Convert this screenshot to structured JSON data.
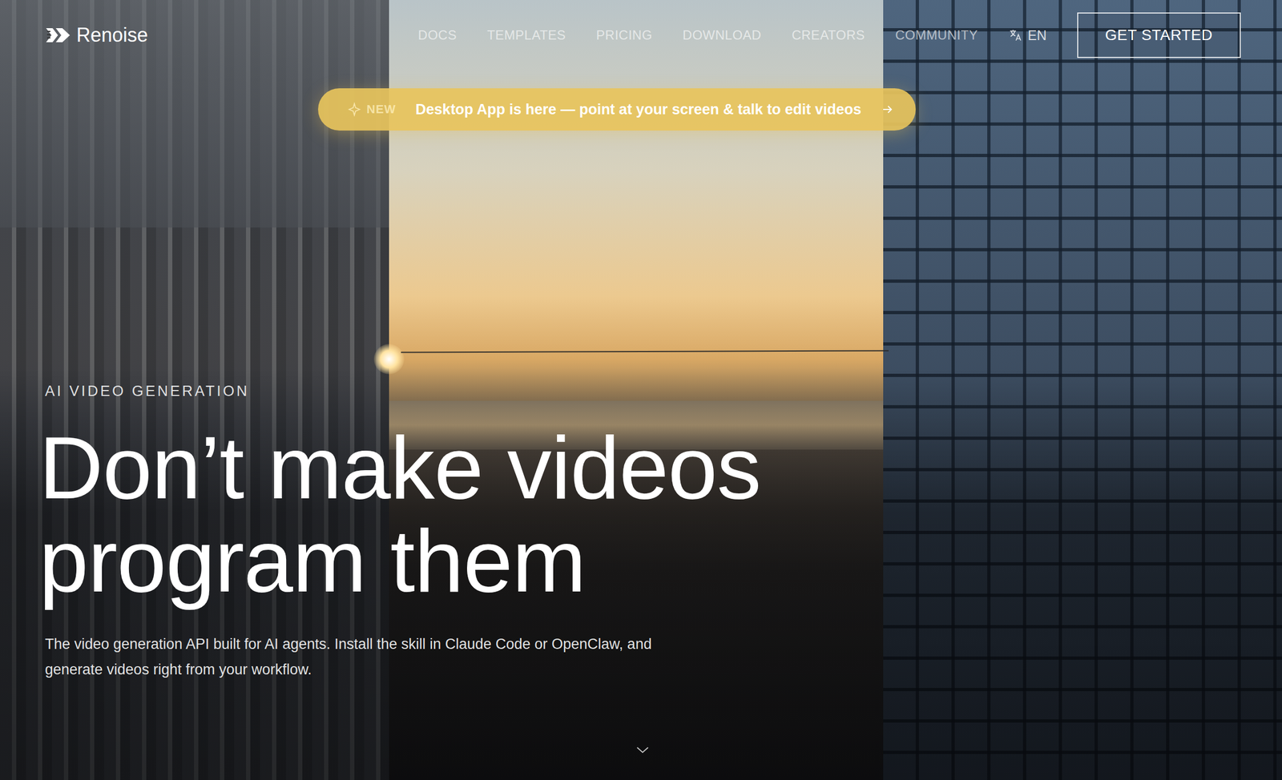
{
  "logo": {
    "text": "Renoise"
  },
  "nav": {
    "links": [
      {
        "label": "DOCS"
      },
      {
        "label": "TEMPLATES"
      },
      {
        "label": "PRICING"
      },
      {
        "label": "DOWNLOAD"
      },
      {
        "label": "CREATORS"
      },
      {
        "label": "COMMUNITY"
      }
    ],
    "language": "EN",
    "cta": "GET STARTED"
  },
  "announcement": {
    "badge": "NEW",
    "text": "Desktop App is here — point at your screen & talk to edit videos"
  },
  "hero": {
    "eyebrow": "AI VIDEO GENERATION",
    "headline": [
      "Don’t make videos",
      "program them"
    ],
    "description": "The video generation API built for AI agents. Install the skill in Claude Code or OpenClaw, and generate videos right from your workflow."
  }
}
